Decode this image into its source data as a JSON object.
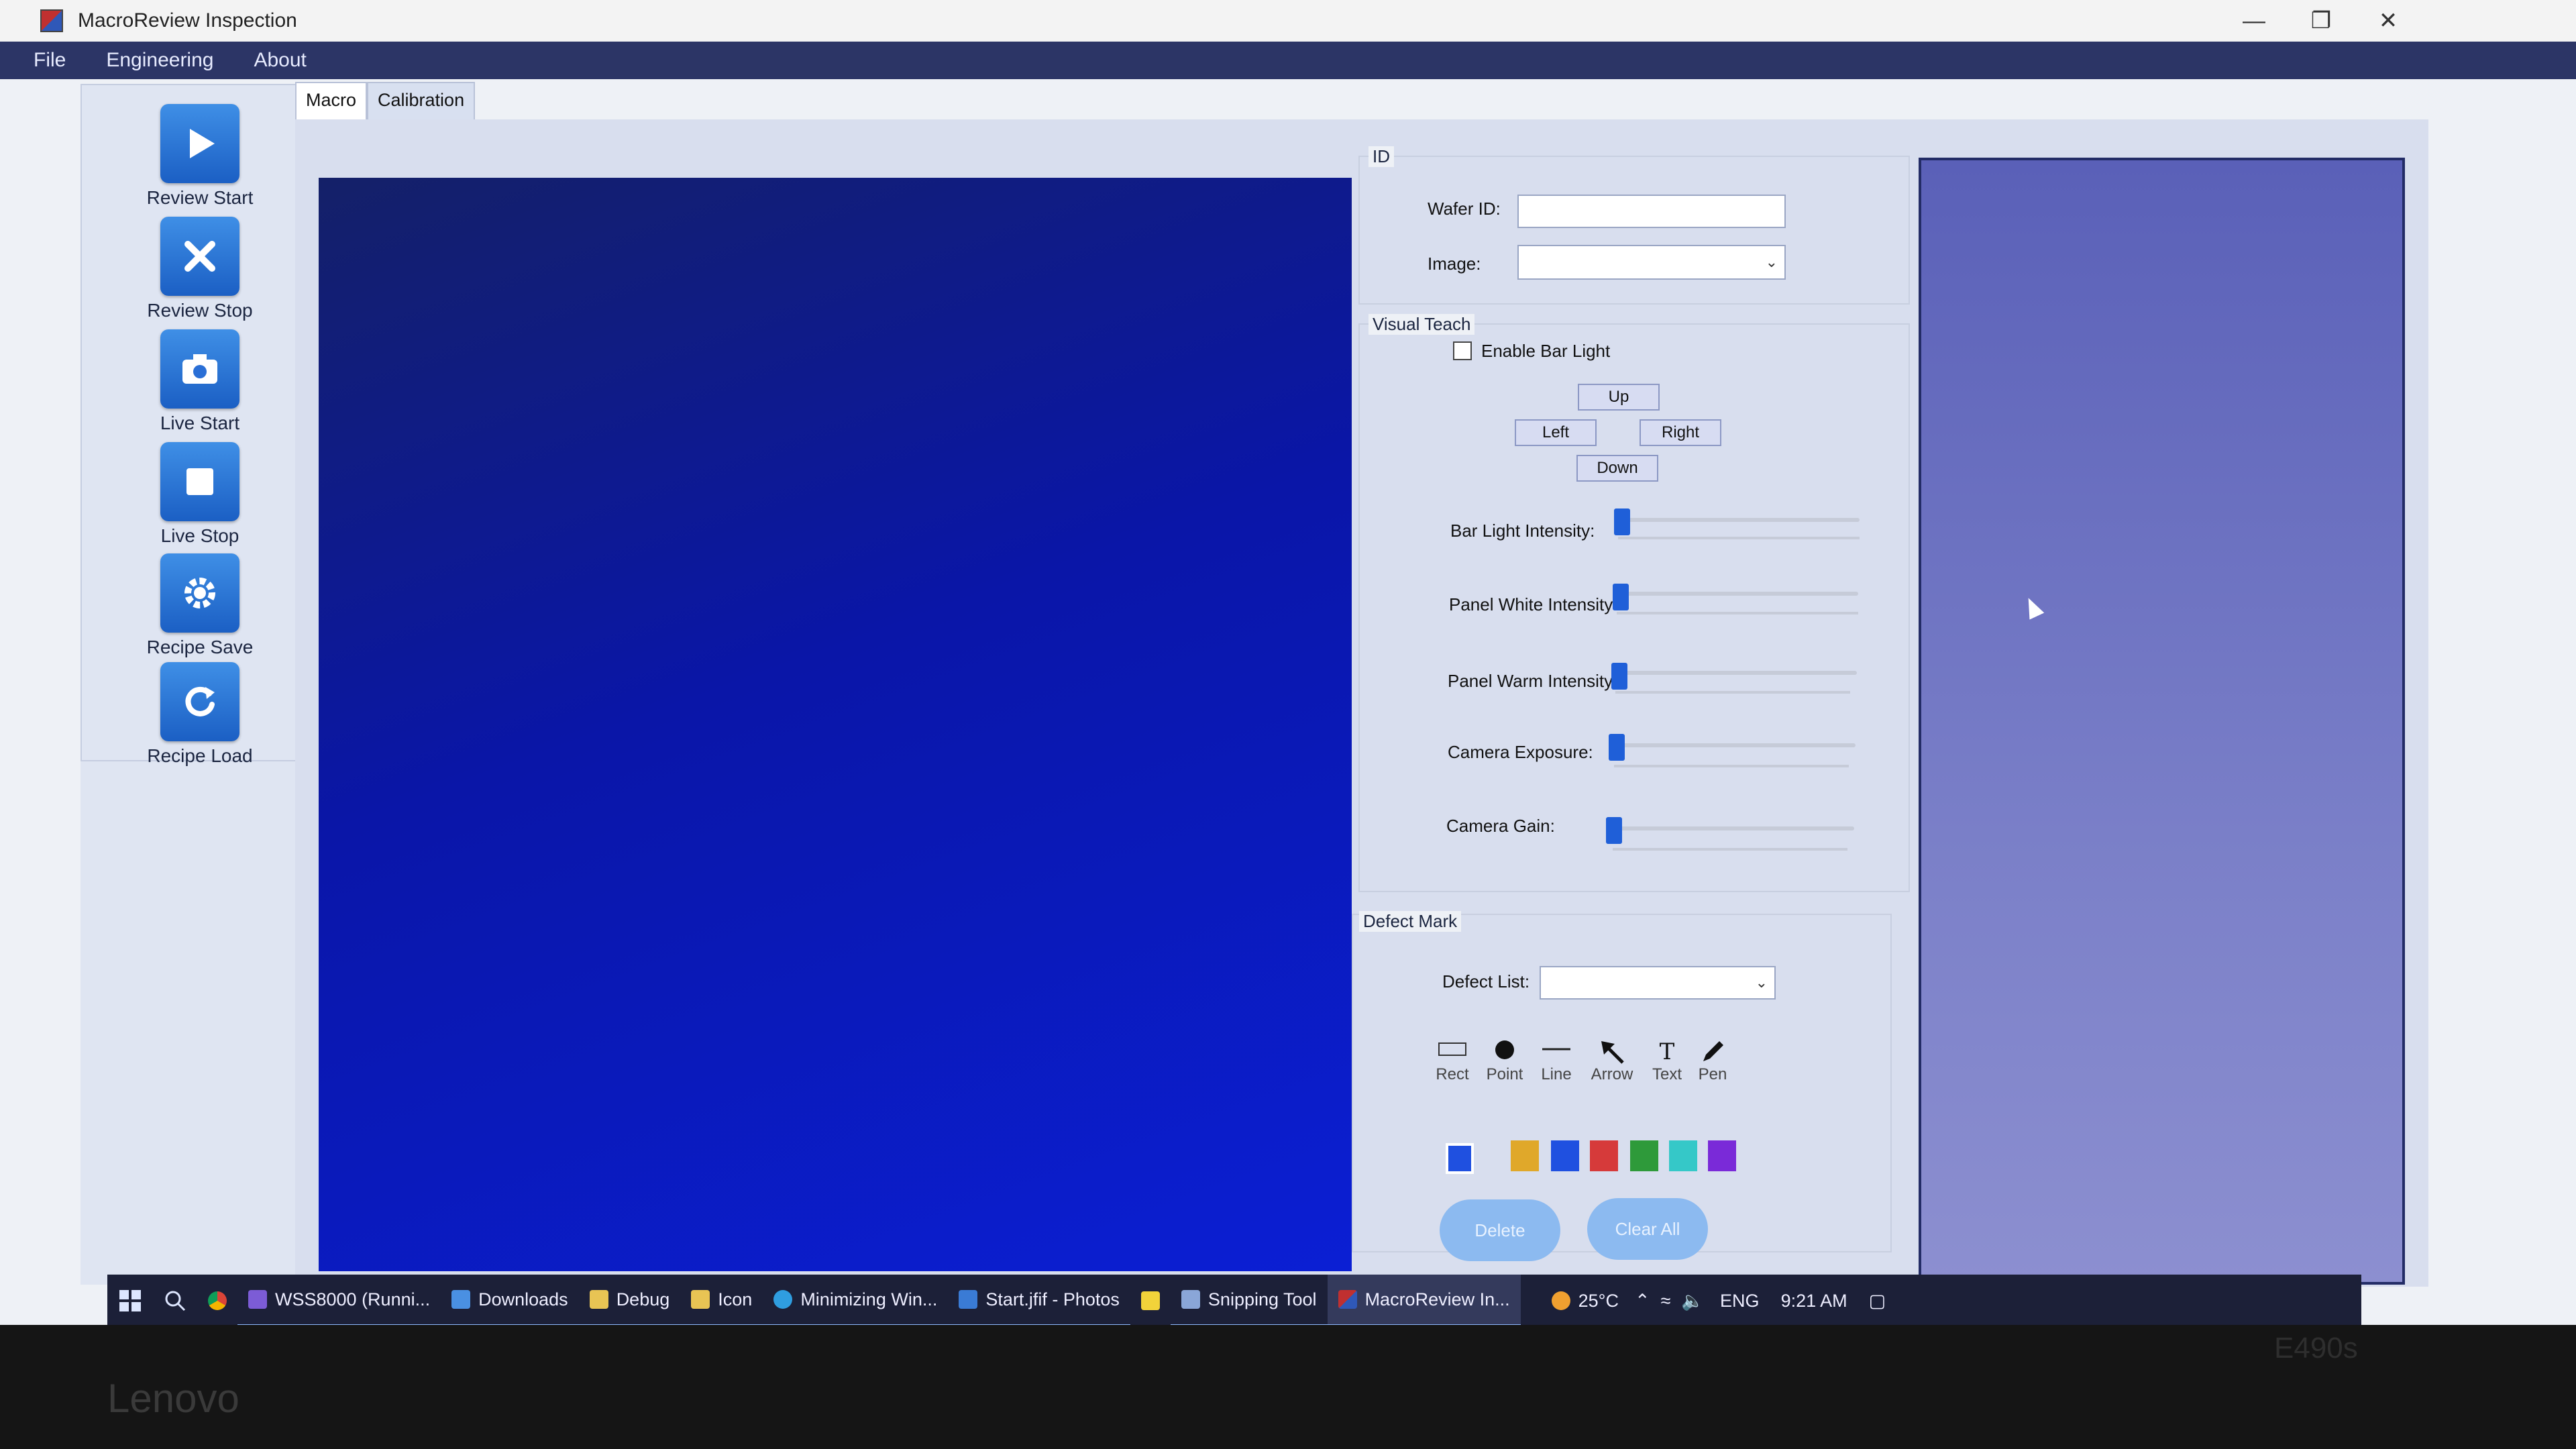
{
  "window": {
    "title": "MacroReview Inspection"
  },
  "menu": [
    "File",
    "Engineering",
    "About"
  ],
  "sidebar": [
    {
      "label": "Review Start",
      "icon": "play-icon"
    },
    {
      "label": "Review Stop",
      "icon": "x-icon"
    },
    {
      "label": "Live Start",
      "icon": "camera-icon"
    },
    {
      "label": "Live Stop",
      "icon": "stop-icon"
    },
    {
      "label": "Recipe Save",
      "icon": "gear-icon"
    },
    {
      "label": "Recipe Load",
      "icon": "refresh-icon"
    }
  ],
  "tabs": [
    {
      "label": "Macro",
      "active": true
    },
    {
      "label": "Calibration",
      "active": false
    }
  ],
  "id_group": {
    "title": "ID",
    "wafer_label": "Wafer ID:",
    "wafer_value": "",
    "image_label": "Image:",
    "image_value": ""
  },
  "visual_teach": {
    "title": "Visual Teach",
    "enable_bar_light": "Enable Bar Light",
    "enable_bar_light_checked": false,
    "up": "Up",
    "left": "Left",
    "right": "Right",
    "down": "Down",
    "sliders": [
      {
        "label": "Bar Light Intensity:",
        "value": 0
      },
      {
        "label": "Panel White Intensity:",
        "value": 0
      },
      {
        "label": "Panel Warm Intensity:",
        "value": 0
      },
      {
        "label": "Camera Exposure:",
        "value": 0
      },
      {
        "label": "Camera Gain:",
        "value": 0
      }
    ]
  },
  "defect_mark": {
    "title": "Defect Mark",
    "defect_list_label": "Defect List:",
    "defect_list_value": "",
    "tools": [
      {
        "label": "Rect",
        "icon": "rect-icon"
      },
      {
        "label": "Point",
        "icon": "point-icon"
      },
      {
        "label": "Line",
        "icon": "line-icon"
      },
      {
        "label": "Arrow",
        "icon": "arrow-icon"
      },
      {
        "label": "Text",
        "icon": "text-icon"
      },
      {
        "label": "Pen",
        "icon": "pen-icon"
      }
    ],
    "selected_color": "#1f50e0",
    "colors": [
      "#e0a82a",
      "#1f50e0",
      "#d63a3a",
      "#2e9a3a",
      "#35c8c8",
      "#7a2ad8"
    ],
    "delete_label": "Delete",
    "clear_all_label": "Clear All"
  },
  "taskbar": {
    "items": [
      "WSS8000 (Runni...",
      "Downloads",
      "Debug",
      "Icon",
      "Minimizing Win...",
      "Start.jfif - Photos",
      "Snipping Tool",
      "MacroReview In..."
    ],
    "weather": "25°C",
    "lang": "ENG",
    "time": "9:21 AM"
  },
  "bezel": {
    "brand": "Lenovo",
    "model": "E490s"
  }
}
